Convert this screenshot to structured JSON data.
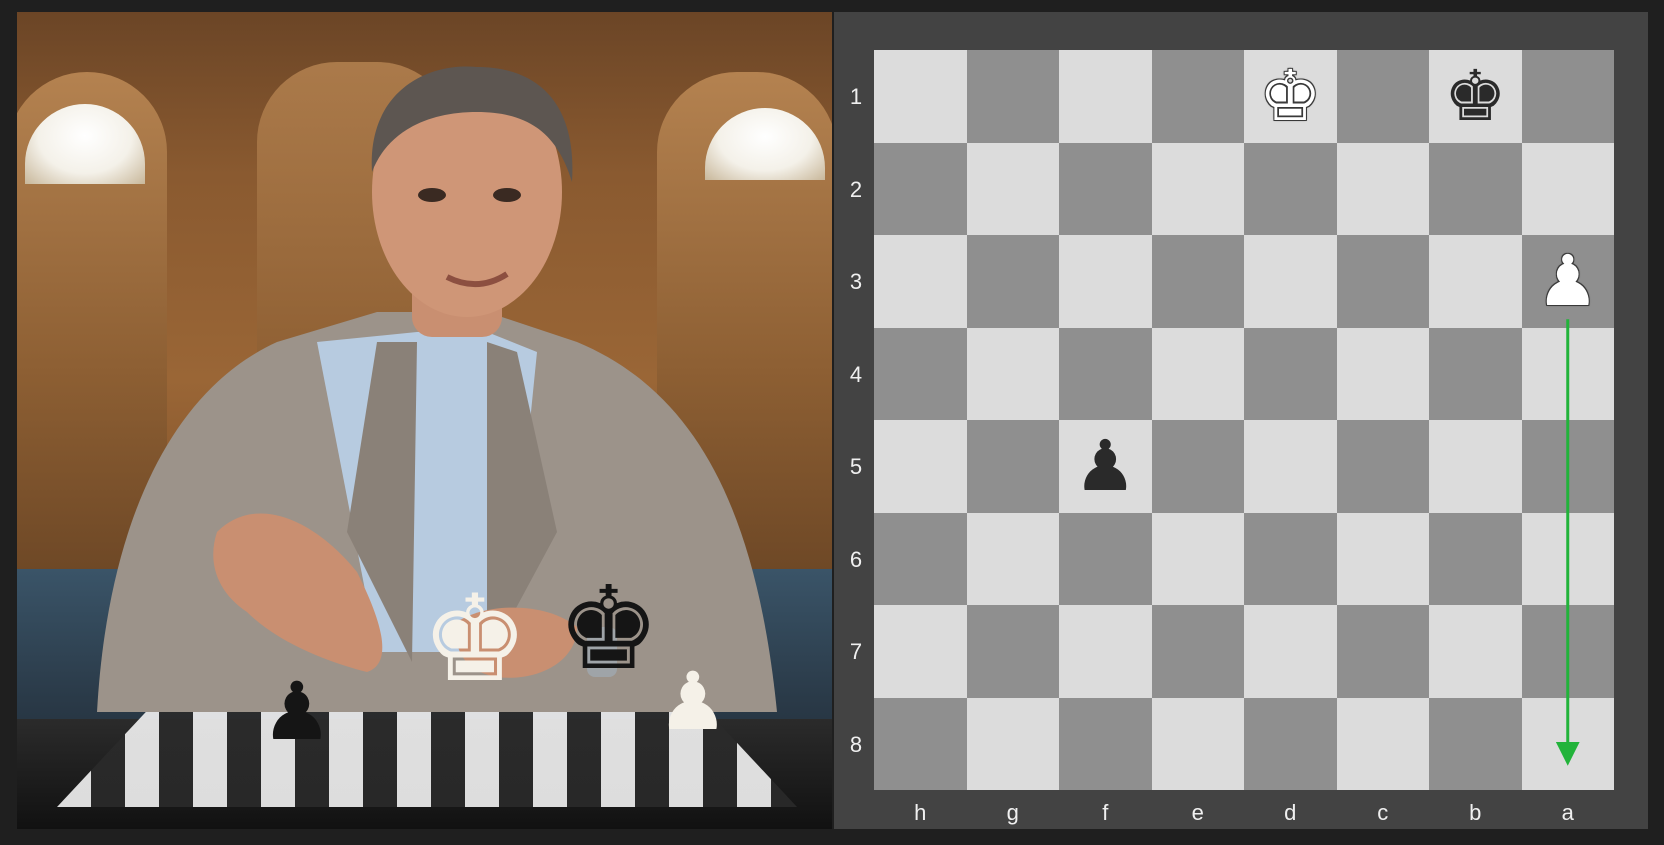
{
  "board": {
    "ranks": [
      "1",
      "2",
      "3",
      "4",
      "5",
      "6",
      "7",
      "8"
    ],
    "files": [
      "h",
      "g",
      "f",
      "e",
      "d",
      "c",
      "b",
      "a"
    ],
    "pieces": [
      {
        "square": "d1",
        "glyph": "♚",
        "side": "white",
        "icon": "white-king-icon"
      },
      {
        "square": "b1",
        "glyph": "♚",
        "side": "black",
        "icon": "black-king-icon"
      },
      {
        "square": "a3",
        "glyph": "♟",
        "side": "white",
        "icon": "white-pawn-icon"
      },
      {
        "square": "f5",
        "glyph": "♟",
        "side": "black",
        "icon": "black-pawn-icon"
      }
    ],
    "arrow": {
      "from": "a3",
      "to": "a8",
      "color": "#22b33a"
    },
    "colors": {
      "light": "#dcdcdc",
      "dark": "#8f8f8f",
      "frame": "#434343"
    }
  },
  "video": {
    "pieces": [
      {
        "glyph": "♚",
        "side": "white",
        "icon": "white-king-icon"
      },
      {
        "glyph": "♚",
        "side": "black",
        "icon": "black-king-icon"
      },
      {
        "glyph": "♟",
        "side": "black",
        "icon": "black-pawn-icon"
      },
      {
        "glyph": "♟",
        "side": "white",
        "icon": "white-pawn-icon"
      }
    ]
  }
}
